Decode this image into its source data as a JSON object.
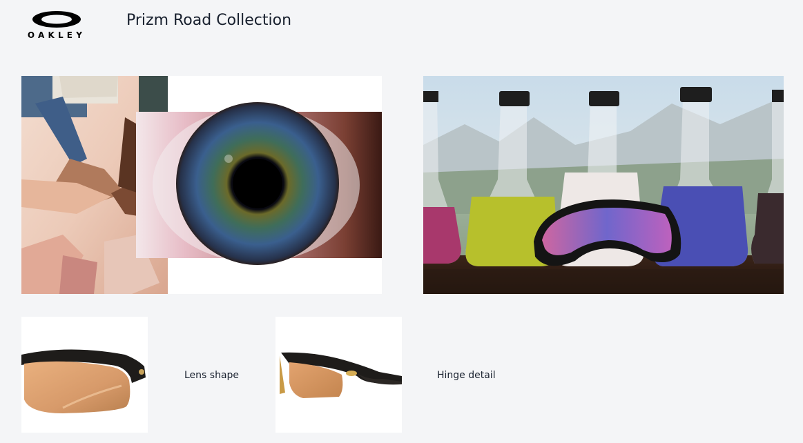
{
  "header": {
    "brand": "OAKLEY",
    "title": "Prizm Road Collection"
  },
  "gallery": {
    "hero_left": {
      "subject": "eye close-up over stacked hands"
    },
    "hero_right": {
      "subject": "sunglasses with lab flasks"
    },
    "products": [
      {
        "caption": "Lens shape"
      },
      {
        "caption": "Hinge detail"
      }
    ]
  },
  "colors": {
    "page_bg": "#f4f5f7",
    "text": "#18202e",
    "lens_gold": "#d9a066",
    "frame": "#1a1a1a"
  }
}
